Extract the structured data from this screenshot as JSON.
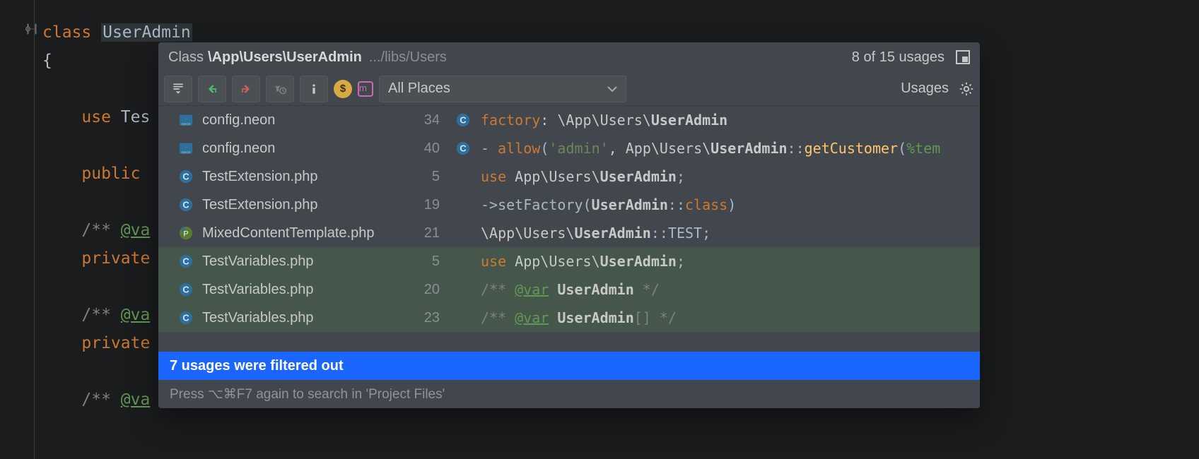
{
  "editor": {
    "lines": [
      {
        "indent": "",
        "kw": "class ",
        "cls": "UserAdmin",
        "cls_hl": true
      },
      {
        "plain": "{"
      },
      {
        "indent": "    ",
        "kw": "use ",
        "rest": "Tes"
      },
      {
        "indent": "    ",
        "kw": "public "
      },
      {
        "indent": "    ",
        "cmt": "/** ",
        "ann": "@va"
      },
      {
        "indent": "    ",
        "kw": "private"
      },
      {
        "indent": "    ",
        "cmt": "/** ",
        "ann": "@va"
      },
      {
        "indent": "    ",
        "kw": "private"
      },
      {
        "indent": "    ",
        "cmt": "/** ",
        "ann": "@va"
      }
    ]
  },
  "popup": {
    "header": {
      "prefix": "Class",
      "fqn": "\\App\\Users\\UserAdmin",
      "path": ".../libs/Users",
      "counter": "8 of 15 usages"
    },
    "scope": "All Places",
    "usages_label": "Usages",
    "results": [
      {
        "file": "config.neon",
        "line": "34",
        "icon": "neon",
        "type_icon": true,
        "green": false,
        "segments": [
          {
            "t": "factory",
            "c": "seg-kw"
          },
          {
            "t": ": \\App\\Users\\",
            "c": "seg-cls"
          },
          {
            "t": "UserAdmin",
            "c": "seg-cls seg-bold"
          }
        ]
      },
      {
        "file": "config.neon",
        "line": "40",
        "icon": "neon",
        "type_icon": true,
        "green": false,
        "segments": [
          {
            "t": "- ",
            "c": "seg-sym"
          },
          {
            "t": "allow",
            "c": "seg-kw"
          },
          {
            "t": "(",
            "c": "seg-sym"
          },
          {
            "t": "'admin'",
            "c": "seg-str"
          },
          {
            "t": ", App\\Users\\",
            "c": "seg-cls"
          },
          {
            "t": "UserAdmin",
            "c": "seg-cls seg-bold"
          },
          {
            "t": "::",
            "c": "seg-sym"
          },
          {
            "t": "getCustomer",
            "c": "seg-fn"
          },
          {
            "t": "(",
            "c": "seg-sym"
          },
          {
            "t": "%tem",
            "c": "seg-mac"
          }
        ]
      },
      {
        "file": "TestExtension.php",
        "line": "5",
        "icon": "class",
        "type_icon": false,
        "green": false,
        "segments": [
          {
            "t": "use ",
            "c": "seg-kw"
          },
          {
            "t": "App\\Users\\",
            "c": "seg-cls"
          },
          {
            "t": "UserAdmin",
            "c": "seg-cls seg-bold"
          },
          {
            "t": ";",
            "c": "seg-sym"
          }
        ]
      },
      {
        "file": "TestExtension.php",
        "line": "19",
        "icon": "class",
        "type_icon": false,
        "green": false,
        "segments": [
          {
            "t": "->setFactory(",
            "c": "seg-sym"
          },
          {
            "t": "UserAdmin",
            "c": "seg-cls seg-bold"
          },
          {
            "t": "::",
            "c": "seg-sym"
          },
          {
            "t": "class",
            "c": "seg-kw"
          },
          {
            "t": ")",
            "c": "seg-sym"
          }
        ]
      },
      {
        "file": "MixedContentTemplate.php",
        "line": "21",
        "icon": "php",
        "type_icon": false,
        "green": false,
        "segments": [
          {
            "t": "\\App\\Users\\",
            "c": "seg-cls"
          },
          {
            "t": "UserAdmin",
            "c": "seg-cls seg-bold"
          },
          {
            "t": "::TEST;",
            "c": "seg-sym"
          }
        ]
      },
      {
        "file": "TestVariables.php",
        "line": "5",
        "icon": "class",
        "type_icon": false,
        "green": true,
        "segments": [
          {
            "t": "use ",
            "c": "seg-kw"
          },
          {
            "t": "App\\Users\\",
            "c": "seg-cls"
          },
          {
            "t": "UserAdmin",
            "c": "seg-cls seg-bold"
          },
          {
            "t": ";",
            "c": "seg-sym"
          }
        ]
      },
      {
        "file": "TestVariables.php",
        "line": "20",
        "icon": "class",
        "type_icon": false,
        "green": true,
        "segments": [
          {
            "t": "/** ",
            "c": "seg-cmt"
          },
          {
            "t": "@var",
            "c": "seg-ann"
          },
          {
            "t": " ",
            "c": ""
          },
          {
            "t": "UserAdmin",
            "c": "seg-cls seg-bold"
          },
          {
            "t": " */",
            "c": "seg-cmt"
          }
        ]
      },
      {
        "file": "TestVariables.php",
        "line": "23",
        "icon": "class",
        "type_icon": false,
        "green": true,
        "segments": [
          {
            "t": "/** ",
            "c": "seg-cmt"
          },
          {
            "t": "@var",
            "c": "seg-ann"
          },
          {
            "t": " ",
            "c": ""
          },
          {
            "t": "UserAdmin",
            "c": "seg-cls seg-bold"
          },
          {
            "t": "[] */",
            "c": "seg-cmt"
          }
        ]
      }
    ],
    "filtered": "7 usages were filtered out",
    "hint": "Press ⌥⌘F7 again to search in 'Project Files'"
  }
}
